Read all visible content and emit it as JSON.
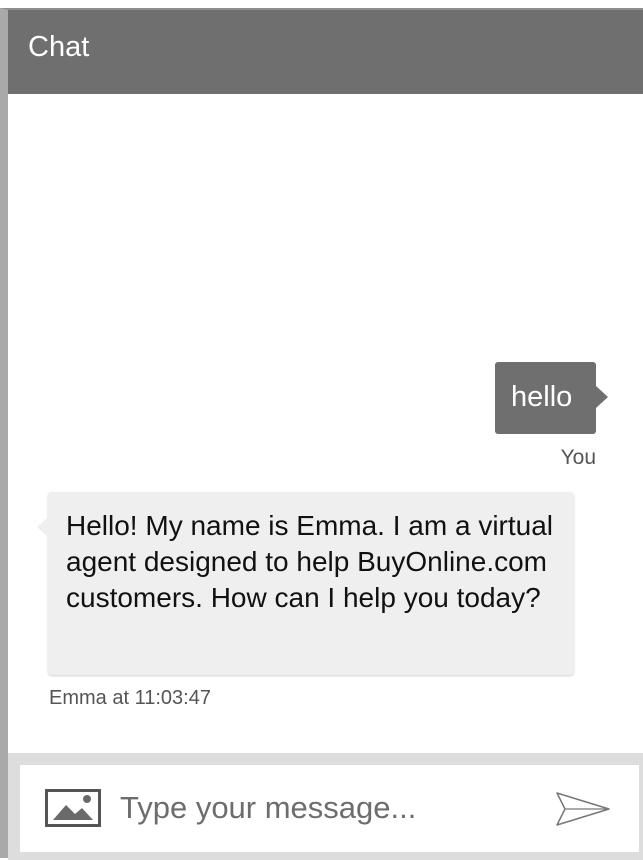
{
  "header": {
    "title": "Chat"
  },
  "messages": [
    {
      "sender": "user",
      "text": "hello",
      "meta": "You"
    },
    {
      "sender": "agent",
      "text": "Hello! My name is Emma. I am a virtual agent designed to help BuyOnline.com customers. How can I help you today?",
      "meta": "Emma at 11:03:47"
    }
  ],
  "composer": {
    "placeholder": "Type your message...",
    "value": ""
  },
  "icons": {
    "image": "image-icon",
    "send": "send-icon"
  },
  "colors": {
    "header_bg": "#6f6f6f",
    "user_bubble": "#6f6f6f",
    "agent_bubble": "#efefef",
    "composer_bg": "#dddddd"
  }
}
